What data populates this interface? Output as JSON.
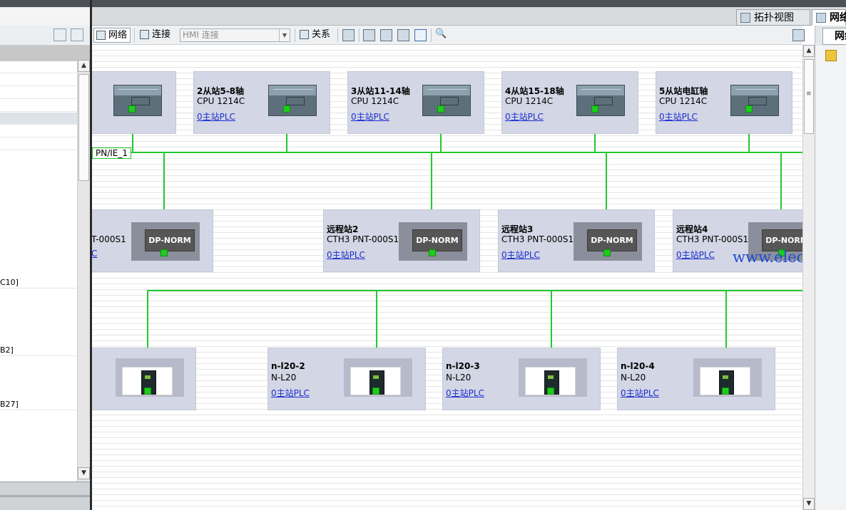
{
  "view_tabs": {
    "topology": "拓扑视图",
    "network": "网络"
  },
  "toolbar": {
    "network_btn": "网络",
    "connect_btn": "连接",
    "hmi_select_value": "HMI 连接",
    "relation_btn": "关系"
  },
  "left_panel": {
    "rows": [
      "C10]",
      "B2]",
      "B27]"
    ]
  },
  "canvas": {
    "network_label": "PN/IE_1",
    "top_row": [
      {
        "name": "",
        "type": "",
        "link": ""
      },
      {
        "name": "2从站5-8轴",
        "type": "CPU 1214C",
        "link": "0主站PLC"
      },
      {
        "name": "3从站11-14轴",
        "type": "CPU 1214C",
        "link": "0主站PLC"
      },
      {
        "name": "4从站15-18轴",
        "type": "CPU 1214C",
        "link": "0主站PLC"
      },
      {
        "name": "5从站电缸轴",
        "type": "CPU 1214C",
        "link": "0主站PLC"
      }
    ],
    "middle_row": [
      {
        "name": "",
        "type": "T-000S1",
        "link": "C",
        "module": "DP-NORM"
      },
      {
        "name": "远程站2",
        "type": "CTH3 PNT-000S1",
        "link": "0主站PLC",
        "module": "DP-NORM"
      },
      {
        "name": "远程站3",
        "type": "CTH3 PNT-000S1",
        "link": "0主站PLC",
        "module": "DP-NORM"
      },
      {
        "name": "远程站4",
        "type": "CTH3 PNT-000S1",
        "link": "0主站PLC",
        "module": "DP-NORM"
      }
    ],
    "bottom_row": [
      {
        "name": "",
        "type": "",
        "link": ""
      },
      {
        "name": "n-l20-2",
        "type": "N-L20",
        "link": "0主站PLC"
      },
      {
        "name": "n-l20-3",
        "type": "N-L20",
        "link": "0主站PLC"
      },
      {
        "name": "n-l20-4",
        "type": "N-L20",
        "link": "0主站PLC"
      }
    ],
    "watermark": "www.eleok.com"
  },
  "colors": {
    "network_line": "#22c82e",
    "device_bg": "#d3d6e4",
    "link_text": "#1a2ed1"
  }
}
